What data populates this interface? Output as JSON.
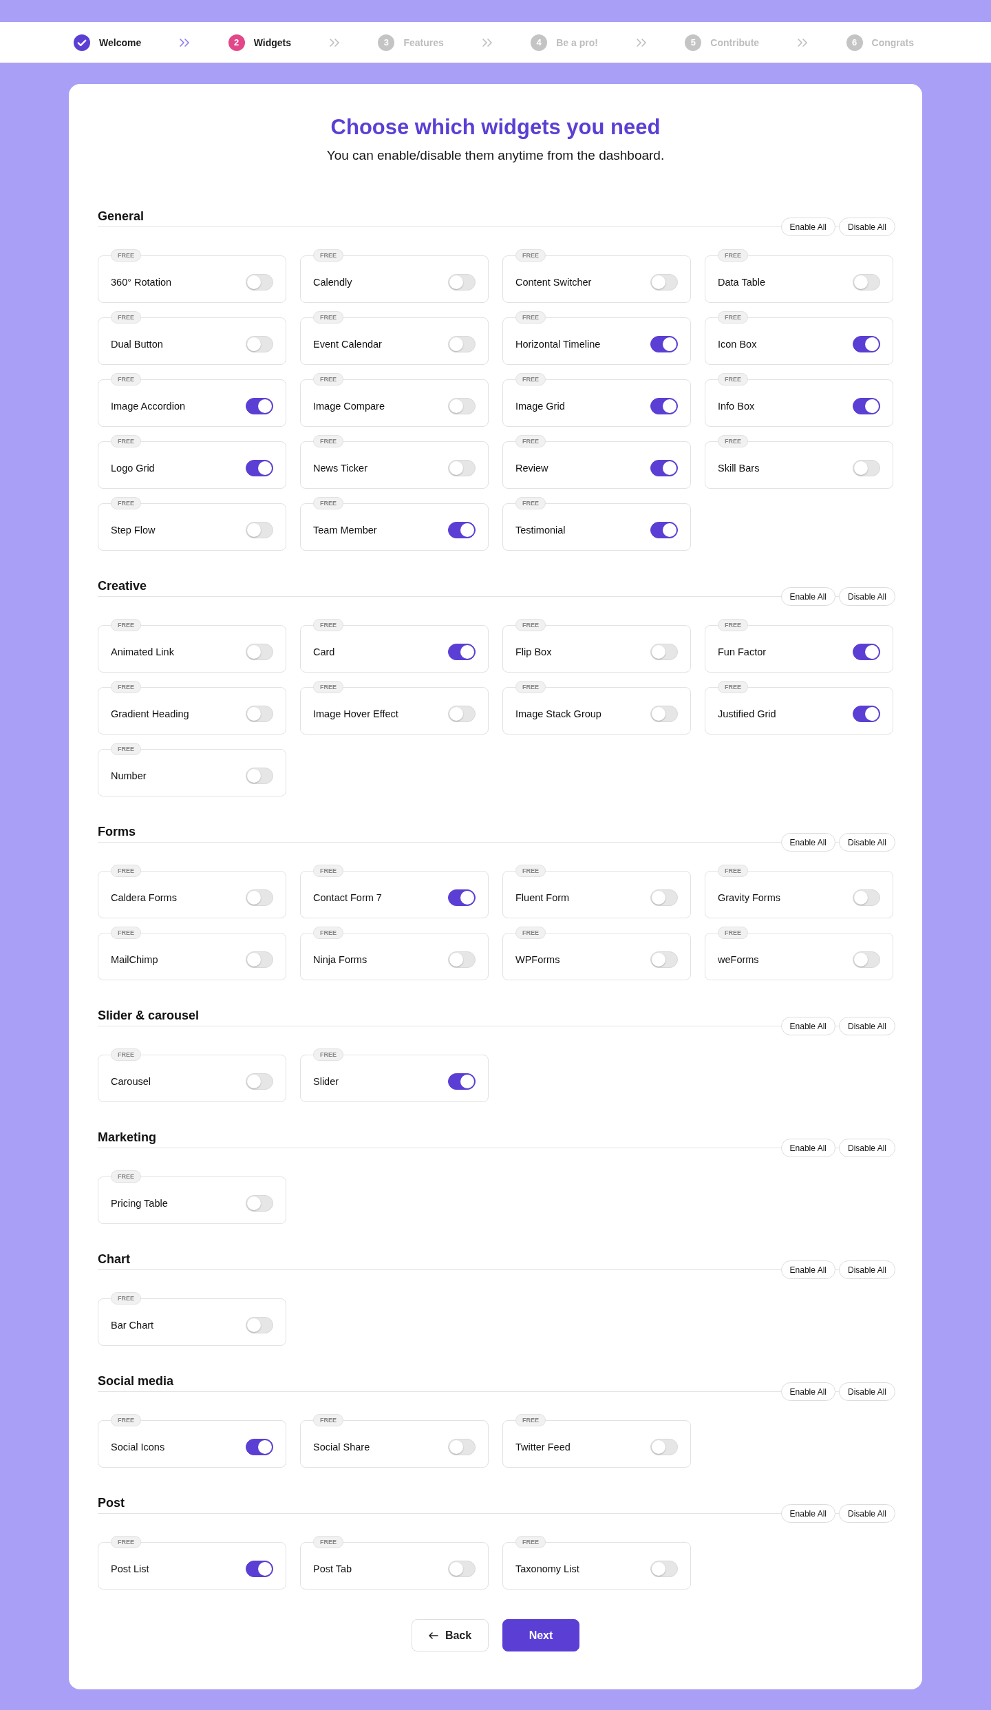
{
  "stepper": {
    "steps": [
      {
        "label": "Welcome",
        "completed": true,
        "selected": false
      },
      {
        "number": "2",
        "label": "Widgets",
        "completed": false,
        "selected": true
      },
      {
        "number": "3",
        "label": "Features",
        "completed": false,
        "selected": false
      },
      {
        "number": "4",
        "label": "Be a pro!",
        "completed": false,
        "selected": false
      },
      {
        "number": "5",
        "label": "Contribute",
        "completed": false,
        "selected": false
      },
      {
        "number": "6",
        "label": "Congrats",
        "completed": false,
        "selected": false
      }
    ]
  },
  "header": {
    "title": "Choose which widgets you need",
    "subtitle": "You can enable/disable them anytime from the dashboard."
  },
  "sections": [
    {
      "title": "General",
      "enable_all": "Enable All",
      "disable_all": "Disable All",
      "widgets": [
        {
          "badge": "FREE",
          "name": "360° Rotation",
          "on": false
        },
        {
          "badge": "FREE",
          "name": "Calendly",
          "on": false
        },
        {
          "badge": "FREE",
          "name": "Content Switcher",
          "on": false
        },
        {
          "badge": "FREE",
          "name": "Data Table",
          "on": false
        },
        {
          "badge": "FREE",
          "name": "Dual Button",
          "on": false
        },
        {
          "badge": "FREE",
          "name": "Event Calendar",
          "on": false
        },
        {
          "badge": "FREE",
          "name": "Horizontal Timeline",
          "on": true
        },
        {
          "badge": "FREE",
          "name": "Icon Box",
          "on": true
        },
        {
          "badge": "FREE",
          "name": "Image Accordion",
          "on": true
        },
        {
          "badge": "FREE",
          "name": "Image Compare",
          "on": false
        },
        {
          "badge": "FREE",
          "name": "Image Grid",
          "on": true
        },
        {
          "badge": "FREE",
          "name": "Info Box",
          "on": true
        },
        {
          "badge": "FREE",
          "name": "Logo Grid",
          "on": true
        },
        {
          "badge": "FREE",
          "name": "News Ticker",
          "on": false
        },
        {
          "badge": "FREE",
          "name": "Review",
          "on": true
        },
        {
          "badge": "FREE",
          "name": "Skill Bars",
          "on": false
        },
        {
          "badge": "FREE",
          "name": "Step Flow",
          "on": false
        },
        {
          "badge": "FREE",
          "name": "Team Member",
          "on": true
        },
        {
          "badge": "FREE",
          "name": "Testimonial",
          "on": true
        }
      ]
    },
    {
      "title": "Creative",
      "enable_all": "Enable All",
      "disable_all": "Disable All",
      "widgets": [
        {
          "badge": "FREE",
          "name": "Animated Link",
          "on": false
        },
        {
          "badge": "FREE",
          "name": "Card",
          "on": true
        },
        {
          "badge": "FREE",
          "name": "Flip Box",
          "on": false
        },
        {
          "badge": "FREE",
          "name": "Fun Factor",
          "on": true
        },
        {
          "badge": "FREE",
          "name": "Gradient Heading",
          "on": false
        },
        {
          "badge": "FREE",
          "name": "Image Hover Effect",
          "on": false
        },
        {
          "badge": "FREE",
          "name": "Image Stack Group",
          "on": false
        },
        {
          "badge": "FREE",
          "name": "Justified Grid",
          "on": true
        },
        {
          "badge": "FREE",
          "name": "Number",
          "on": false
        }
      ]
    },
    {
      "title": "Forms",
      "enable_all": "Enable All",
      "disable_all": "Disable All",
      "widgets": [
        {
          "badge": "FREE",
          "name": "Caldera Forms",
          "on": false
        },
        {
          "badge": "FREE",
          "name": "Contact Form 7",
          "on": true
        },
        {
          "badge": "FREE",
          "name": "Fluent Form",
          "on": false
        },
        {
          "badge": "FREE",
          "name": "Gravity Forms",
          "on": false
        },
        {
          "badge": "FREE",
          "name": "MailChimp",
          "on": false
        },
        {
          "badge": "FREE",
          "name": "Ninja Forms",
          "on": false
        },
        {
          "badge": "FREE",
          "name": "WPForms",
          "on": false
        },
        {
          "badge": "FREE",
          "name": "weForms",
          "on": false
        }
      ]
    },
    {
      "title": "Slider & carousel",
      "enable_all": "Enable All",
      "disable_all": "Disable All",
      "widgets": [
        {
          "badge": "FREE",
          "name": "Carousel",
          "on": false
        },
        {
          "badge": "FREE",
          "name": "Slider",
          "on": true
        }
      ]
    },
    {
      "title": "Marketing",
      "enable_all": "Enable All",
      "disable_all": "Disable All",
      "widgets": [
        {
          "badge": "FREE",
          "name": "Pricing Table",
          "on": false
        }
      ]
    },
    {
      "title": "Chart",
      "enable_all": "Enable All",
      "disable_all": "Disable All",
      "widgets": [
        {
          "badge": "FREE",
          "name": "Bar Chart",
          "on": false
        }
      ]
    },
    {
      "title": "Social media",
      "enable_all": "Enable All",
      "disable_all": "Disable All",
      "widgets": [
        {
          "badge": "FREE",
          "name": "Social Icons",
          "on": true
        },
        {
          "badge": "FREE",
          "name": "Social Share",
          "on": false
        },
        {
          "badge": "FREE",
          "name": "Twitter Feed",
          "on": false
        }
      ]
    },
    {
      "title": "Post",
      "enable_all": "Enable All",
      "disable_all": "Disable All",
      "widgets": [
        {
          "badge": "FREE",
          "name": "Post List",
          "on": true
        },
        {
          "badge": "FREE",
          "name": "Post Tab",
          "on": false
        },
        {
          "badge": "FREE",
          "name": "Taxonomy List",
          "on": false
        }
      ]
    }
  ],
  "buttons": {
    "back": "Back",
    "next": "Next"
  }
}
